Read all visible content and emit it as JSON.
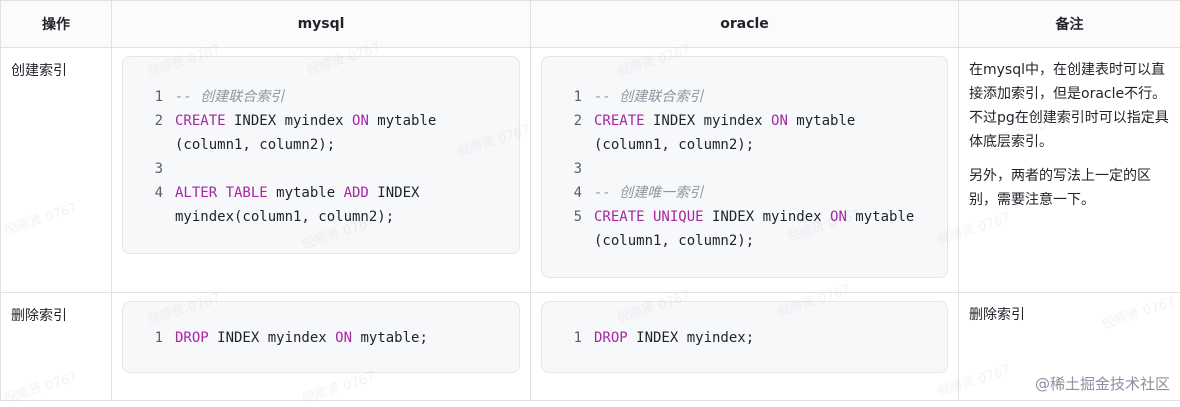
{
  "header": {
    "col_op": "操作",
    "col_mysql": "mysql",
    "col_oracle": "oracle",
    "col_note": "备注"
  },
  "rows": [
    {
      "op": "创建索引",
      "mysql": [
        {
          "n": "1",
          "tokens": [
            {
              "t": "-- 创建联合索引",
              "c": "cm"
            }
          ]
        },
        {
          "n": "2",
          "tokens": [
            {
              "t": "CREATE",
              "c": "kw"
            },
            {
              "t": " INDEX myindex ",
              "c": ""
            },
            {
              "t": "ON",
              "c": "kw"
            },
            {
              "t": " mytable (column1, column2);",
              "c": ""
            }
          ]
        },
        {
          "n": "3",
          "tokens": [
            {
              "t": " ",
              "c": ""
            }
          ]
        },
        {
          "n": "4",
          "tokens": [
            {
              "t": "ALTER TABLE",
              "c": "kw"
            },
            {
              "t": " mytable ",
              "c": ""
            },
            {
              "t": "ADD",
              "c": "kw"
            },
            {
              "t": " INDEX myindex(column1, column2);",
              "c": ""
            }
          ]
        }
      ],
      "oracle": [
        {
          "n": "1",
          "tokens": [
            {
              "t": "-- 创建联合索引",
              "c": "cm"
            }
          ]
        },
        {
          "n": "2",
          "tokens": [
            {
              "t": "CREATE",
              "c": "kw"
            },
            {
              "t": " INDEX myindex ",
              "c": ""
            },
            {
              "t": "ON",
              "c": "kw"
            },
            {
              "t": " mytable (column1, column2);",
              "c": ""
            }
          ]
        },
        {
          "n": "3",
          "tokens": [
            {
              "t": " ",
              "c": ""
            }
          ]
        },
        {
          "n": "4",
          "tokens": [
            {
              "t": "-- 创建唯一索引",
              "c": "cm"
            }
          ]
        },
        {
          "n": "5",
          "tokens": [
            {
              "t": "CREATE UNIQUE",
              "c": "kw"
            },
            {
              "t": " INDEX myindex ",
              "c": ""
            },
            {
              "t": "ON",
              "c": "kw"
            },
            {
              "t": " mytable (column1, column2);",
              "c": ""
            }
          ]
        }
      ],
      "note": [
        "在mysql中，在创建表时可以直接添加索引，但是oracle不行。不过pg在创建索引时可以指定具体底层索引。",
        "另外，两者的写法上一定的区别，需要注意一下。"
      ]
    },
    {
      "op": "删除索引",
      "mysql": [
        {
          "n": "1",
          "tokens": [
            {
              "t": "DROP",
              "c": "kw"
            },
            {
              "t": " INDEX myindex ",
              "c": ""
            },
            {
              "t": "ON",
              "c": "kw"
            },
            {
              "t": " mytable;",
              "c": ""
            }
          ]
        }
      ],
      "oracle": [
        {
          "n": "1",
          "tokens": [
            {
              "t": "DROP",
              "c": "kw"
            },
            {
              "t": " INDEX myindex;",
              "c": ""
            }
          ]
        }
      ],
      "note": [
        "删除索引"
      ]
    }
  ],
  "watermark": "倪顺贤 0767",
  "brand": "@稀土掘金技术社区"
}
